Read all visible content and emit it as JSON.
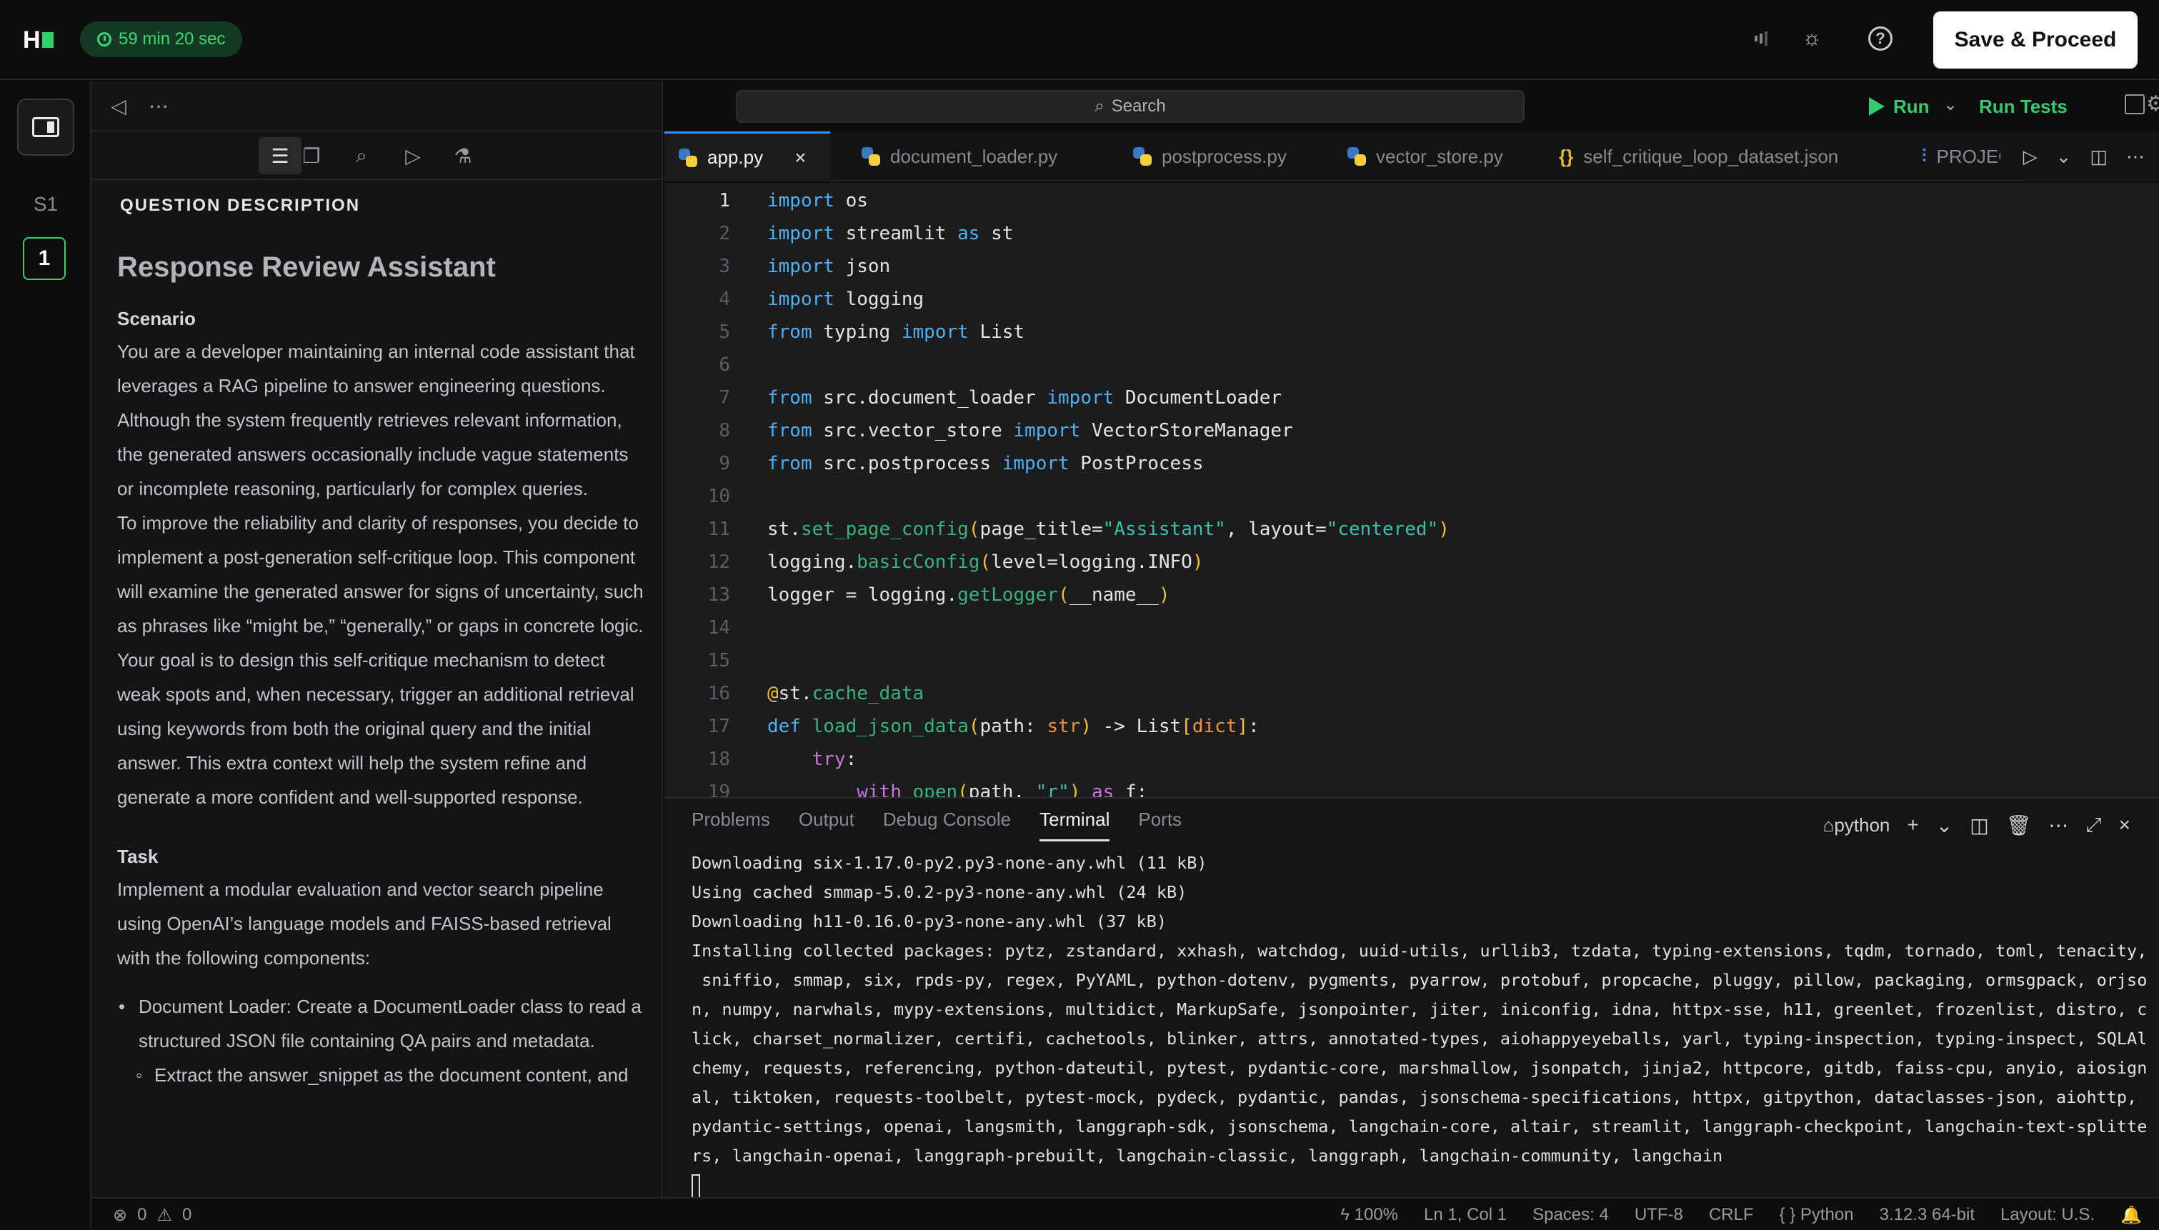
{
  "topbar": {
    "logo_text": "H",
    "timer": "59 min 20 sec",
    "save_label": "Save & Proceed"
  },
  "rail": {
    "section": "S1",
    "question_number": "1"
  },
  "question": {
    "heading": "QUESTION DESCRIPTION",
    "title": "Response Review Assistant",
    "scenario_label": "Scenario",
    "scenario_p1": "You are a developer maintaining an internal code assistant that leverages a RAG pipeline to answer engineering questions. Although the system frequently retrieves relevant information, the generated answers occasionally include vague statements or incomplete reasoning, particularly for complex queries.",
    "scenario_p2": "To improve the reliability and clarity of responses, you decide to implement a post-generation self-critique loop. This component will examine the generated answer for signs of uncertainty, such as phrases like “might be,” “generally,” or gaps in concrete logic. Your goal is to design this self-critique mechanism to detect weak spots and, when necessary, trigger an additional retrieval using keywords from both the original query and the initial answer. This extra context will help the system refine and generate a more confident and well-supported response.",
    "task_label": "Task",
    "task_p1": "Implement a modular evaluation and vector search pipeline using OpenAI’s language models and FAISS-based retrieval with the following components:",
    "list": [
      "Document Loader: Create a DocumentLoader class to read a structured JSON file containing QA pairs and metadata."
    ],
    "sublist": [
      "Extract the answer_snippet as the document content, and"
    ]
  },
  "editor": {
    "search_placeholder": "Search",
    "run_label": "Run",
    "run_tests_label": "Run Tests",
    "tabs": [
      {
        "label": "app.py",
        "icon": "python-icon"
      },
      {
        "label": "document_loader.py",
        "icon": "python-icon"
      },
      {
        "label": "postprocess.py",
        "icon": "python-icon"
      },
      {
        "label": "vector_store.py",
        "icon": "python-icon"
      },
      {
        "label": "self_critique_loop_dataset.json",
        "icon": "json-icon"
      },
      {
        "label": "PROJEC",
        "icon": "project-icon"
      }
    ],
    "line_numbers": [
      "1",
      "2",
      "3",
      "4",
      "5",
      "6",
      "7",
      "8",
      "9",
      "10",
      "11",
      "12",
      "13",
      "14",
      "15",
      "16",
      "17",
      "18",
      "19"
    ]
  },
  "terminal": {
    "tabs": [
      "Problems",
      "Output",
      "Debug Console",
      "Terminal",
      "Ports"
    ],
    "shell": "python",
    "lines": [
      "Downloading six-1.17.0-py2.py3-none-any.whl (11 kB)",
      "Using cached smmap-5.0.2-py3-none-any.whl (24 kB)",
      "Downloading h11-0.16.0-py3-none-any.whl (37 kB)",
      "Installing collected packages: pytz, zstandard, xxhash, watchdog, uuid-utils, urllib3, tzdata, typing-extensions, tqdm, tornado, toml, tenacity,",
      " sniffio, smmap, six, rpds-py, regex, PyYAML, python-dotenv, pygments, pyarrow, protobuf, propcache, pluggy, pillow, packaging, ormsgpack, orjso",
      "n, numpy, narwhals, mypy-extensions, multidict, MarkupSafe, jsonpointer, jiter, iniconfig, idna, httpx-sse, h11, greenlet, frozenlist, distro, c",
      "lick, charset_normalizer, certifi, cachetools, blinker, attrs, annotated-types, aiohappyeyeballs, yarl, typing-inspection, typing-inspect, SQLAl",
      "chemy, requests, referencing, python-dateutil, pytest, pydantic-core, marshmallow, jsonpatch, jinja2, httpcore, gitdb, faiss-cpu, anyio, aiosign",
      "al, tiktoken, requests-toolbelt, pytest-mock, pydeck, pydantic, pandas, jsonschema-specifications, httpx, gitpython, dataclasses-json, aiohttp,",
      "pydantic-settings, openai, langsmith, langgraph-sdk, jsonschema, langchain-core, altair, streamlit, langgraph-checkpoint, langchain-text-splitte",
      "rs, langchain-openai, langgraph-prebuilt, langchain-classic, langgraph, langchain-community, langchain"
    ]
  },
  "status": {
    "errors": "0",
    "warnings": "0",
    "zoom": "100%",
    "position": "Ln 1, Col 1",
    "spaces": "Spaces: 4",
    "encoding": "UTF-8",
    "eol": "CRLF",
    "language": "Python",
    "interpreter": "3.12.3 64-bit",
    "layout": "Layout: U.S."
  },
  "colors": {
    "accent": "#2ed36a",
    "keyword": "#4fb0f0",
    "function": "#37b47a",
    "string": "#3cc0a4"
  }
}
